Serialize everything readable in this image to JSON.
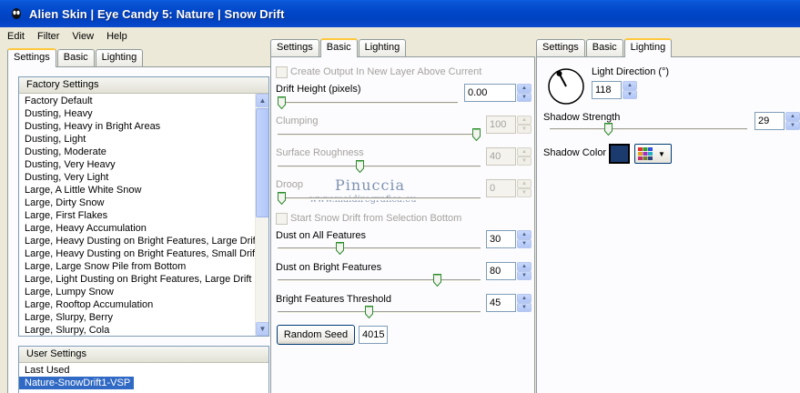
{
  "window": {
    "title": "Alien Skin | Eye Candy 5: Nature | Snow Drift"
  },
  "menu": [
    "Edit",
    "Filter",
    "View",
    "Help"
  ],
  "left_tabs": [
    "Settings",
    "Basic",
    "Lighting"
  ],
  "factory": {
    "header": "Factory Settings",
    "items": [
      "Factory Default",
      "Dusting, Heavy",
      "Dusting, Heavy in Bright Areas",
      "Dusting, Light",
      "Dusting, Moderate",
      "Dusting, Very Heavy",
      "Dusting, Very Light",
      "Large, A Little White Snow",
      "Large, Dirty Snow",
      "Large, First Flakes",
      "Large, Heavy Accumulation",
      "Large, Heavy Dusting on Bright Features, Large Drift",
      "Large, Heavy Dusting on Bright Features, Small Drift",
      "Large, Large Snow Pile from Bottom",
      "Large, Light Dusting on Bright Features, Large Drift",
      "Large, Lumpy Snow",
      "Large, Rooftop Accumulation",
      "Large, Slurpy, Berry",
      "Large, Slurpy, Cola"
    ]
  },
  "user": {
    "header": "User Settings",
    "items": [
      "Last Used",
      "Nature-SnowDrift1-VSP"
    ]
  },
  "basic_tabs": [
    "Settings",
    "Basic",
    "Lighting"
  ],
  "basic": {
    "create_output_label": "Create Output In New Layer Above Current",
    "drift_height": {
      "label": "Drift Height (pixels)",
      "value": "0.00",
      "slider": 0.0
    },
    "clumping": {
      "label": "Clumping",
      "value": "100",
      "slider": 1.0
    },
    "surface_roughness": {
      "label": "Surface Roughness",
      "value": "40",
      "slider": 0.4
    },
    "droop": {
      "label": "Droop",
      "value": "0",
      "slider": 0.0
    },
    "start_from_selection_label": "Start Snow Drift from Selection Bottom",
    "dust_all": {
      "label": "Dust on All Features",
      "value": "30",
      "slider": 0.3
    },
    "dust_bright": {
      "label": "Dust on Bright Features",
      "value": "80",
      "slider": 0.8
    },
    "bright_threshold": {
      "label": "Bright Features Threshold",
      "value": "45",
      "slider": 0.45
    },
    "random_seed": {
      "button_label": "Random Seed",
      "value": "4015"
    }
  },
  "watermark": {
    "title": "Pinuccia",
    "url": "www.maidiregrafica.eu"
  },
  "lighting_tabs": [
    "Settings",
    "Basic",
    "Lighting"
  ],
  "lighting": {
    "light_direction": {
      "label": "Light Direction (°)",
      "value": "118"
    },
    "shadow_strength": {
      "label": "Shadow Strength",
      "value": "29",
      "slider": 0.29
    },
    "shadow_color": {
      "label": "Shadow Color",
      "color": "#1b3a6e"
    }
  },
  "colors": {
    "titlebar": "#0046c8",
    "selection": "#316ac5",
    "active_tab_accent": "#ffc83c"
  }
}
